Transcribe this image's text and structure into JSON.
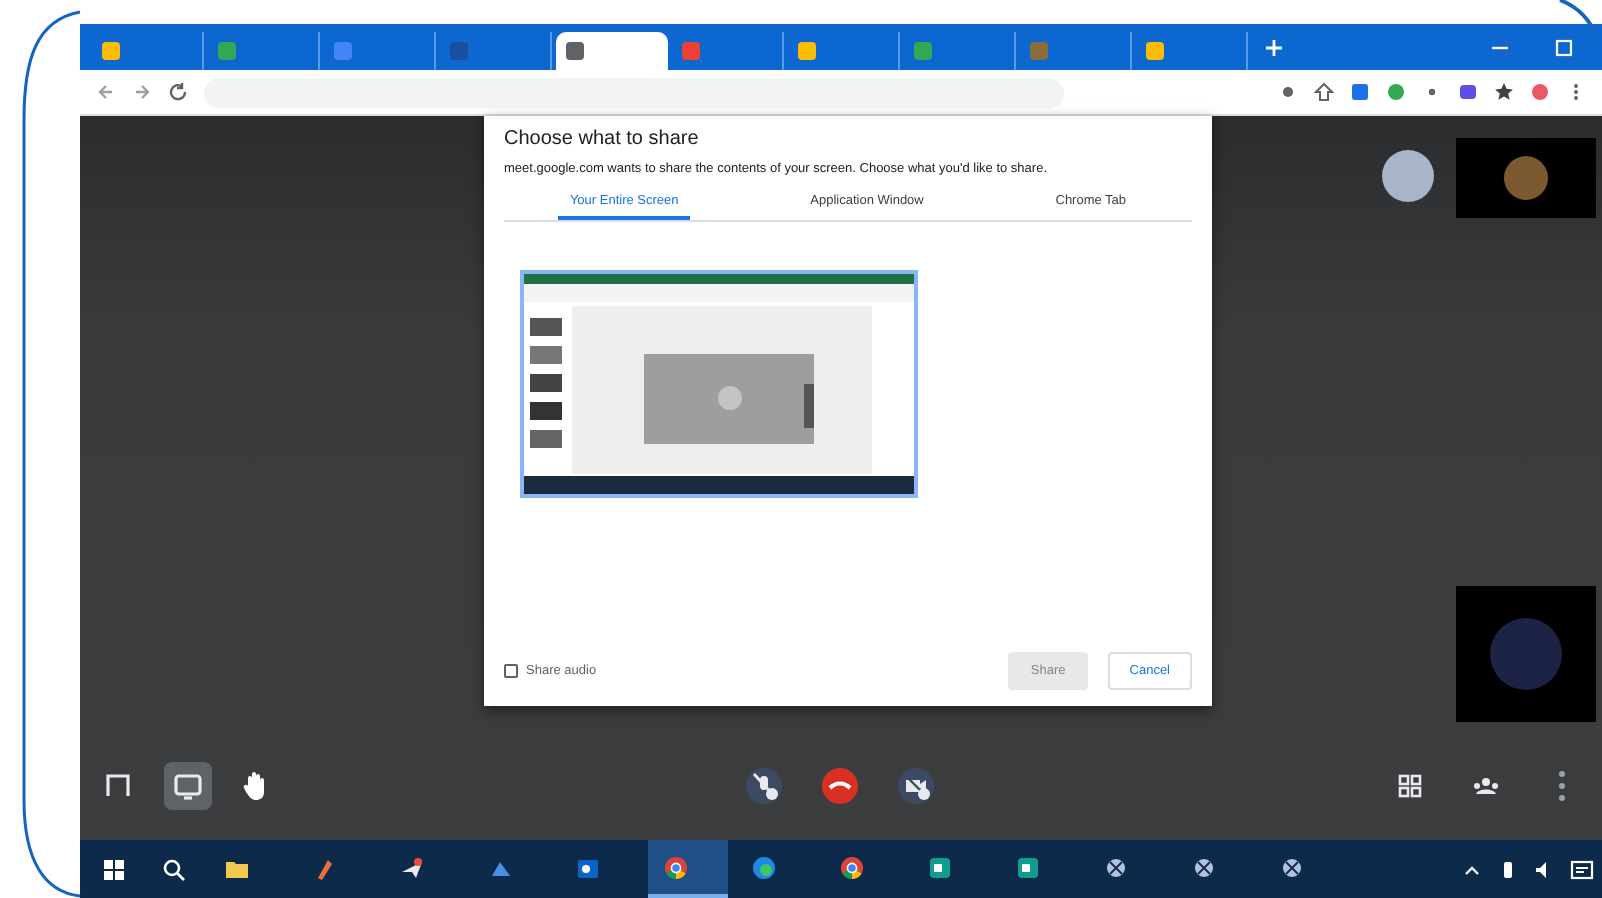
{
  "browser_tabs": [
    {
      "color": "#fbbc04",
      "selected": false
    },
    {
      "color": "#34a853",
      "selected": false
    },
    {
      "color": "#4285f4",
      "selected": false
    },
    {
      "color": "#1a4fa0",
      "selected": false
    },
    {
      "color": "#5f6368",
      "selected": true
    },
    {
      "color": "#ea4335",
      "selected": false
    },
    {
      "color": "#fbbc04",
      "selected": false
    },
    {
      "color": "#34a853",
      "selected": false
    },
    {
      "color": "#8a6d3b",
      "selected": false
    },
    {
      "color": "#fbbc04",
      "selected": false
    }
  ],
  "dialog": {
    "title": "Choose what to share",
    "subtitle": "meet.google.com wants to share the contents of your screen. Choose what you'd like to share.",
    "tabs": [
      {
        "label": "Your Entire Screen",
        "selected": true
      },
      {
        "label": "Application Window",
        "selected": false
      },
      {
        "label": "Chrome Tab",
        "selected": false
      }
    ],
    "share_audio": {
      "label": "Share audio",
      "checked": false
    },
    "buttons": [
      {
        "label": "Share",
        "kind": "disabled"
      },
      {
        "label": "Cancel",
        "kind": "outlined"
      }
    ]
  },
  "controls": {
    "left": [
      {
        "kind": "captions",
        "selected": false
      },
      {
        "kind": "present",
        "selected": true
      },
      {
        "kind": "hand",
        "selected": false
      }
    ],
    "center": [
      {
        "kind": "mic-off"
      },
      {
        "kind": "end-call"
      },
      {
        "kind": "camera-off"
      }
    ],
    "right": [
      {
        "kind": "grid"
      },
      {
        "kind": "people"
      },
      {
        "kind": "more"
      }
    ]
  },
  "taskbar": {
    "apps": [
      {
        "kind": "folder",
        "selected": false
      },
      {
        "kind": "paint",
        "selected": false
      },
      {
        "kind": "plane",
        "selected": false
      },
      {
        "kind": "docs",
        "selected": false
      },
      {
        "kind": "outlook",
        "selected": false
      },
      {
        "kind": "chrome",
        "selected": true
      },
      {
        "kind": "edge",
        "selected": false
      },
      {
        "kind": "chrome",
        "selected": false
      },
      {
        "kind": "teal",
        "selected": false
      },
      {
        "kind": "teal",
        "selected": false
      },
      {
        "kind": "snip",
        "selected": false
      },
      {
        "kind": "snip",
        "selected": false
      },
      {
        "kind": "snip",
        "selected": false
      }
    ]
  }
}
